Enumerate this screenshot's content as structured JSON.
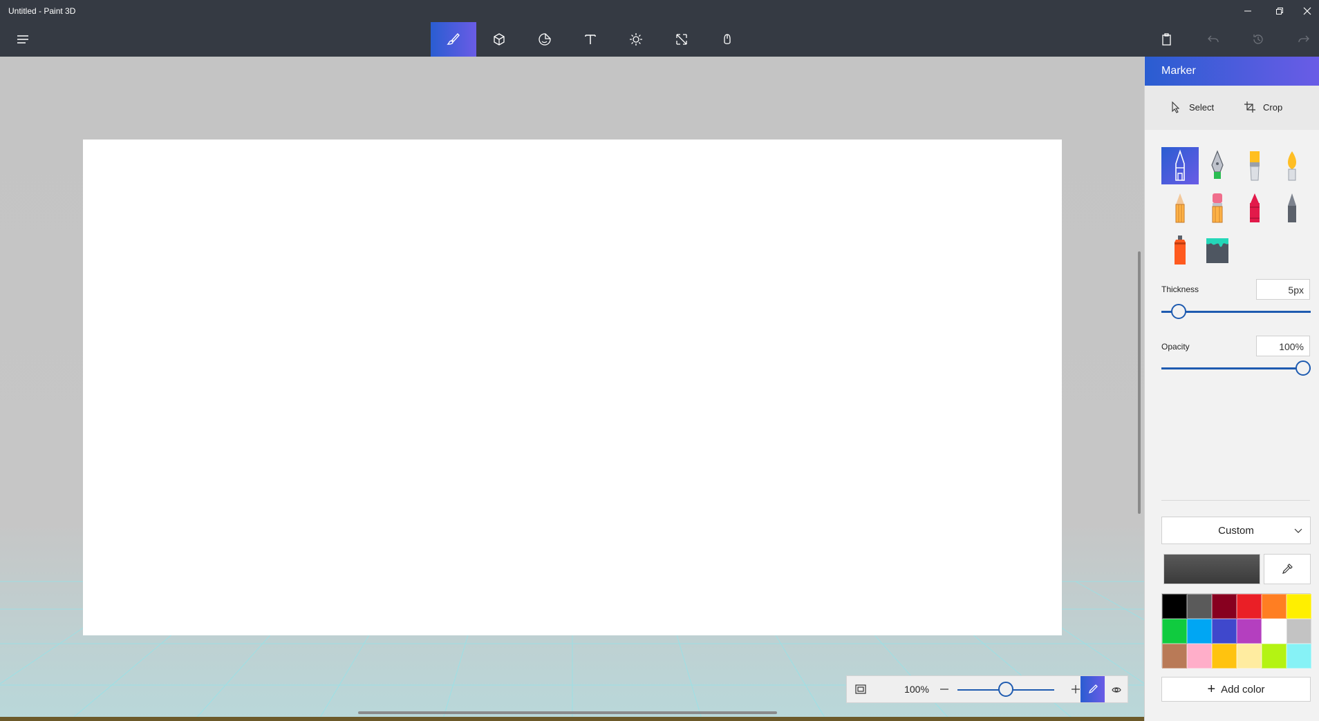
{
  "window": {
    "title": "Untitled - Paint 3D"
  },
  "toolbar": {
    "tools": [
      {
        "name": "brushes-icon"
      },
      {
        "name": "3d-shapes-icon"
      },
      {
        "name": "stickers-icon"
      },
      {
        "name": "text-icon"
      },
      {
        "name": "effects-icon"
      },
      {
        "name": "canvas-icon"
      },
      {
        "name": "magic-select-icon"
      }
    ]
  },
  "panel": {
    "title": "Marker",
    "select_label": "Select",
    "crop_label": "Crop",
    "thickness_label": "Thickness",
    "thickness_value": "5px",
    "thickness_level": 0.07,
    "opacity_label": "Opacity",
    "opacity_value": "100%",
    "opacity_level": 1.0,
    "palette_mode": "Custom",
    "current_color": "#595959",
    "add_color_label": "Add color",
    "swatches": [
      "#000000",
      "#5a5a5a",
      "#87001f",
      "#ea1f26",
      "#ff7e22",
      "#ffef00",
      "#10cb3f",
      "#00a6f3",
      "#3f48cc",
      "#b43fbf",
      "#ffffff",
      "#c3c3c3",
      "#b97a57",
      "#ffaec9",
      "#ffc30f",
      "#ffeca0",
      "#b4f313",
      "#86f2f6"
    ]
  },
  "zoom": {
    "value": "100%",
    "level": 0.5
  },
  "colors": {
    "accent": "#2a5dd1",
    "accent2": "#6a5ce6",
    "chrome": "#353a43"
  }
}
